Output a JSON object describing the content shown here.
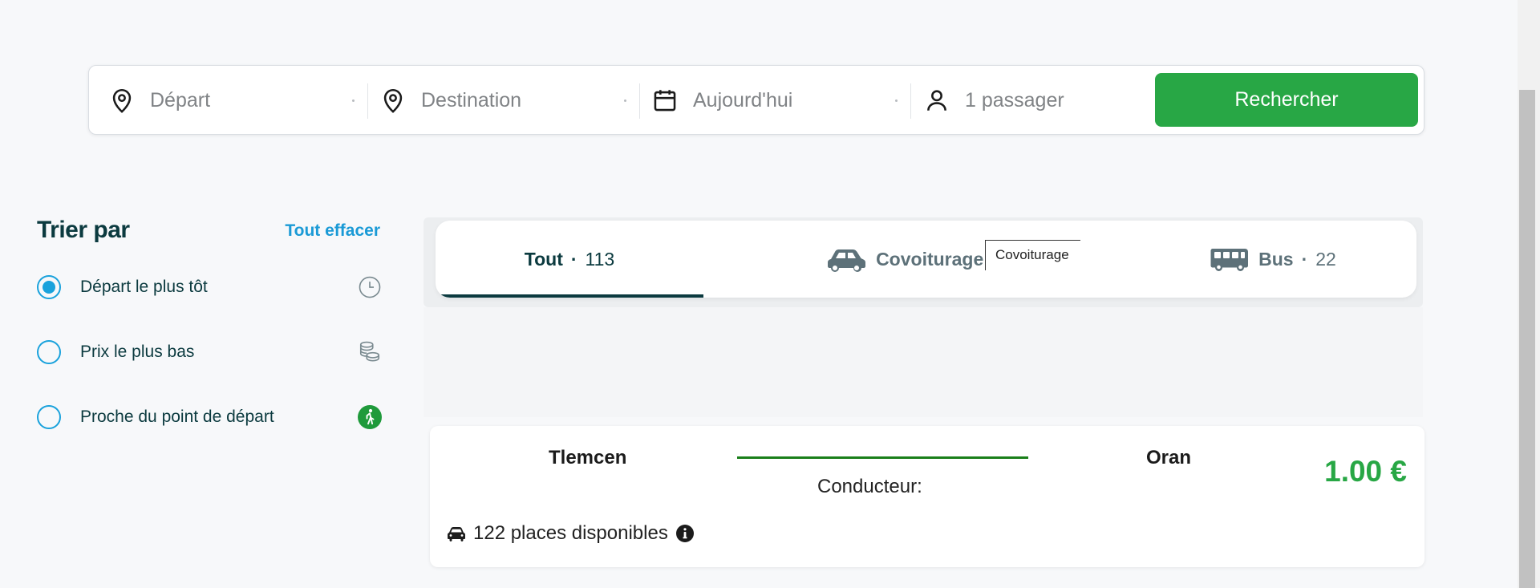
{
  "search": {
    "departure_placeholder": "Départ",
    "destination_placeholder": "Destination",
    "date_placeholder": "Aujourd'hui",
    "passengers_label": "1 passager",
    "search_button": "Rechercher",
    "button_color": "#28a745"
  },
  "sort": {
    "title": "Trier par",
    "clear_all": "Tout effacer",
    "options": [
      {
        "label": "Départ le plus tôt",
        "selected": true,
        "icon": "clock-icon"
      },
      {
        "label": "Prix le plus bas",
        "selected": false,
        "icon": "coins-icon"
      },
      {
        "label": "Proche du point de départ",
        "selected": false,
        "icon": "walking-person-icon"
      }
    ]
  },
  "tabs": [
    {
      "label": "Tout",
      "separator": "·",
      "count": "113",
      "active": true
    },
    {
      "label": "Covoiturage",
      "separator": "·",
      "count": "",
      "icon": "car-icon",
      "active": false
    },
    {
      "label": "Bus",
      "separator": "·",
      "count": "22",
      "icon": "bus-icon",
      "active": false
    }
  ],
  "tooltip": {
    "text": "Covoiturage"
  },
  "result": {
    "from": "Tlemcen",
    "to": "Oran",
    "driver_label": "Conducteur:",
    "price": "1.00 €",
    "seats": "122 places disponibles",
    "accent_color": "#28a745"
  }
}
